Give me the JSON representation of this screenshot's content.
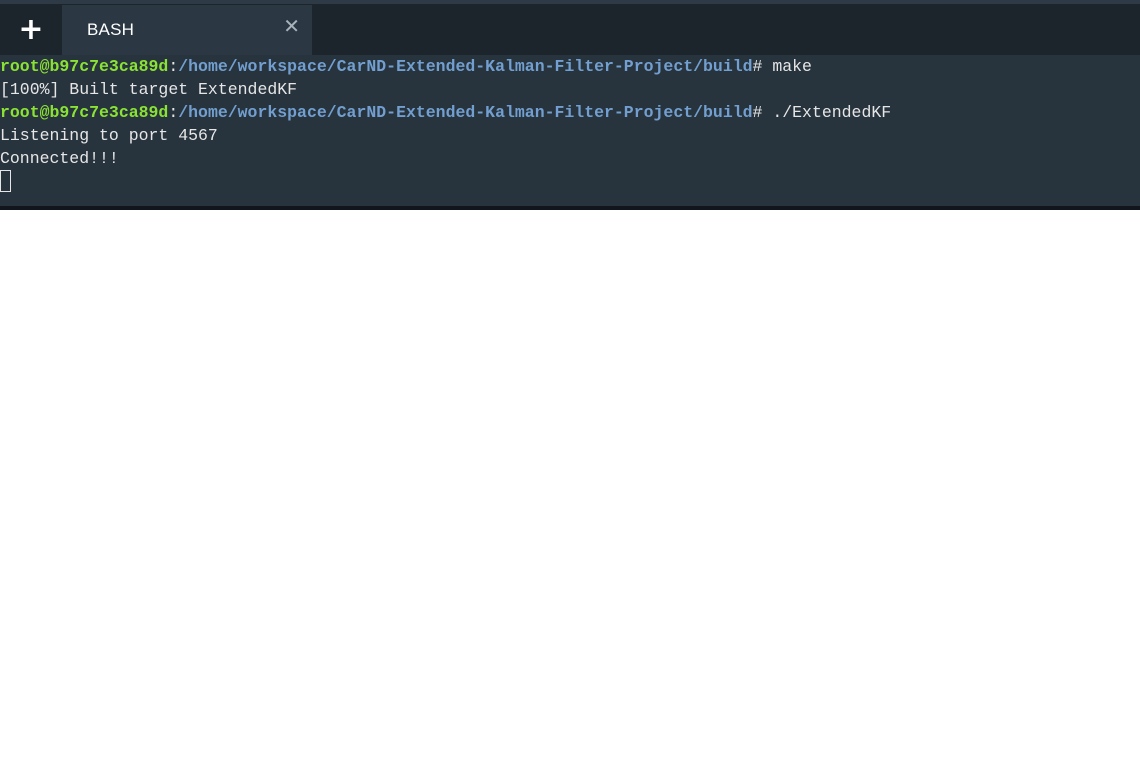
{
  "tab_bar": {
    "new_tab_glyph": "+",
    "new_tab_icon": "plus-icon",
    "tab_label": "BASH",
    "close_glyph": "✕",
    "close_icon": "close-icon"
  },
  "terminal": {
    "lines": [
      {
        "type": "prompt",
        "user": "root@b97c7e3ca89d",
        "colon": ":",
        "path": "/home/workspace/CarND-Extended-Kalman-Filter-Project/build",
        "hash": "#",
        "command": " make"
      },
      {
        "type": "output",
        "text": "[100%] Built target ExtendedKF"
      },
      {
        "type": "prompt",
        "user": "root@b97c7e3ca89d",
        "colon": ":",
        "path": "/home/workspace/CarND-Extended-Kalman-Filter-Project/build",
        "hash": "#",
        "command": " ./ExtendedKF"
      },
      {
        "type": "output",
        "text": "Listening to port 4567"
      },
      {
        "type": "output",
        "text": "Connected!!!"
      }
    ]
  },
  "colors": {
    "terminal_bg": "#27333d",
    "tab_bar_bg": "#1d252c",
    "active_tab_bg": "#2b3844",
    "prompt_user": "#8ae234",
    "prompt_path": "#729fcf",
    "text": "#e6e6e6"
  }
}
